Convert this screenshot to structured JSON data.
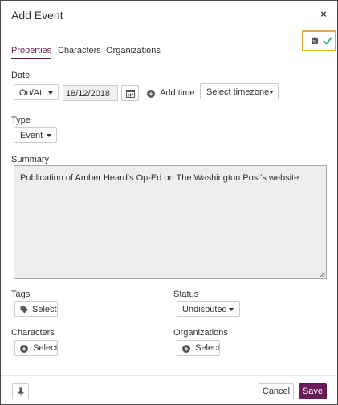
{
  "header": {
    "title": "Add Event",
    "close_label": "×"
  },
  "tabs": [
    {
      "label": "Properties",
      "active": true
    },
    {
      "label": "Characters",
      "active": false
    },
    {
      "label": "Organizations",
      "active": false
    }
  ],
  "date": {
    "label": "Date",
    "qualifier": "On/At",
    "value": "18/12/2018",
    "add_time_label": "Add time",
    "timezone_placeholder": "Select timezone"
  },
  "type": {
    "label": "Type",
    "value": "Event"
  },
  "summary": {
    "label": "Summary",
    "text": "Publication of Amber Heard's Op-Ed on The Washington Post's website"
  },
  "tags": {
    "label": "Tags",
    "button_label": "Select"
  },
  "status": {
    "label": "Status",
    "value": "Undisputed"
  },
  "characters": {
    "label": "Characters",
    "button_label": "Select"
  },
  "organizations": {
    "label": "Organizations",
    "button_label": "Select"
  },
  "footer": {
    "cancel_label": "Cancel",
    "save_label": "Save"
  },
  "colors": {
    "accent": "#6a1b5a",
    "highlight": "#f0a830",
    "check": "#3cb371"
  },
  "icons": [
    "close-icon",
    "robot-icon",
    "check-icon",
    "calendar-icon",
    "plus-circle-icon",
    "tag-icon",
    "pin-icon"
  ]
}
